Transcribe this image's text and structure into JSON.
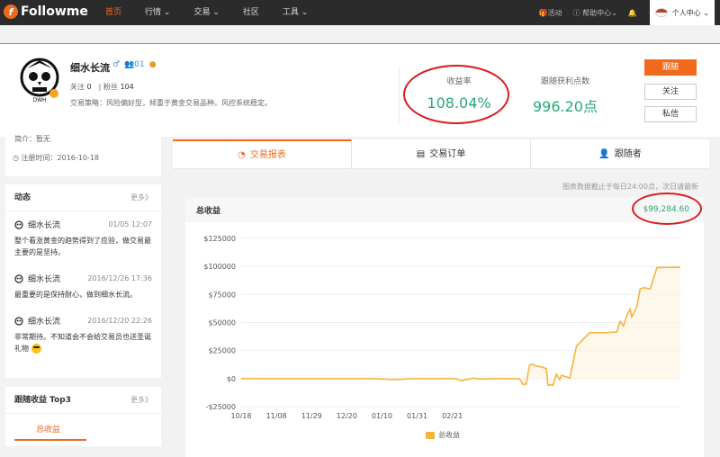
{
  "brand": {
    "name": "Followme"
  },
  "nav": [
    {
      "label": "首页",
      "active": true
    },
    {
      "label": "行情",
      "caret": true
    },
    {
      "label": "交易",
      "caret": true
    },
    {
      "label": "社区"
    },
    {
      "label": "工具",
      "caret": true
    }
  ],
  "topright": {
    "activity": "活动",
    "help": "帮助中心",
    "user": "个人中心"
  },
  "profile": {
    "name": "细水长流",
    "badge_count": "01",
    "follow_label": "关注",
    "follow_count": "0",
    "fans_label": "粉丝",
    "fans_count": "104",
    "strategy": "交易策略：风险偏好型，倾重于黄金交易品种。风控系统稳定。",
    "info_partial": "简介：暂无",
    "register": "注册时间：2016-10-18"
  },
  "kpis": {
    "return_label": "收益率",
    "return_value": "108.04%",
    "points_label": "跟随获利点数",
    "points_value": "996.20点"
  },
  "buttons": {
    "follow": "跟随",
    "watch": "关注",
    "message": "私信"
  },
  "tabs": [
    {
      "label": "交易报表",
      "active": true
    },
    {
      "label": "交易订单"
    },
    {
      "label": "跟随者"
    }
  ],
  "chart_note": "图表数据截止于每日24:00点，次日请最新",
  "feed": {
    "title": "动态",
    "more": "更多》",
    "items": [
      {
        "name": "细水长流",
        "time": "01/05 12:07",
        "text1": "整个看涨黄金的趋势得到了应验，做交易最",
        "text2": "主要的是坚持。"
      },
      {
        "name": "细水长流",
        "time": "2016/12/26 17:36",
        "text1": "最重要的是保持耐心，做到细水长流。",
        "text2": ""
      },
      {
        "name": "细水长流",
        "time": "2016/12/20 22:26",
        "text1": "非常期待。不知道会不会给交易员也送圣诞",
        "text2": "礼物"
      }
    ]
  },
  "top3": {
    "title": "跟随收益 Top3",
    "more": "更多》",
    "tab": "总收益"
  },
  "colors": {
    "accent": "#f06a1c",
    "green": "#2aa876",
    "line": "#f5b342",
    "annotation": "#d81c1c"
  },
  "chart_data": {
    "type": "area",
    "title": "总收益",
    "total": "$99,284.60",
    "legend": "总收益",
    "ylim": [
      -25000,
      125000
    ],
    "yticks": [
      "$125000",
      "$100000",
      "$75000",
      "$50000",
      "$25000",
      "$0",
      "-$25000"
    ],
    "xticks": [
      "10/18",
      "11/08",
      "11/29",
      "12/20",
      "01/10",
      "01/31",
      "02/21"
    ],
    "xrange_days": [
      0,
      136
    ],
    "x_days": [
      0,
      60,
      78,
      92,
      102,
      115,
      128,
      130,
      132,
      134,
      136,
      138,
      140,
      145,
      150,
      160,
      166,
      168,
      170,
      172,
      174,
      175,
      177,
      180,
      182,
      183,
      185,
      186,
      188,
      190,
      191,
      193,
      196,
      200,
      208,
      212,
      215,
      218,
      224,
      226,
      228,
      230,
      232,
      233,
      236,
      238,
      240,
      244,
      248,
      262
    ],
    "y": [
      0,
      0,
      0,
      -1000,
      0,
      0,
      0,
      -1500,
      -1800,
      -1000,
      -500,
      500,
      0,
      -500,
      0,
      0,
      -300,
      -5000,
      -5000,
      12000,
      13000,
      11500,
      11000,
      10000,
      9000,
      -6000,
      -5500,
      -6000,
      4000,
      -1000,
      3000,
      2000,
      500,
      29000,
      41000,
      41000,
      41000,
      41000,
      41500,
      51000,
      47000,
      56000,
      62000,
      55000,
      64000,
      80000,
      81000,
      80000,
      99000,
      99284.6
    ]
  }
}
